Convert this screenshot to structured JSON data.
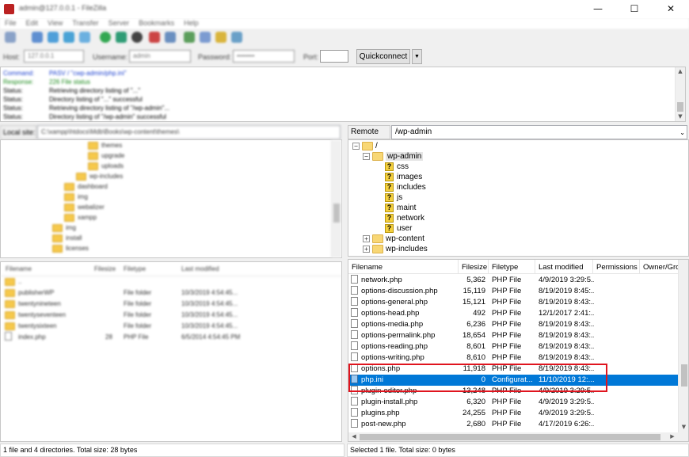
{
  "window": {
    "title": "admin@127.0.0.1 - FileZilla",
    "controls": {
      "minimize": "—",
      "maximize": "☐",
      "close": "✕"
    }
  },
  "menu": [
    "File",
    "Edit",
    "View",
    "Transfer",
    "Server",
    "Bookmarks",
    "Help"
  ],
  "quickconnect": {
    "host_label": "Host:",
    "host_value": "127.0.0.1",
    "username_label": "Username:",
    "username_value": "admin",
    "password_label": "Password:",
    "password_value": "••••••••",
    "port_label": "Port:",
    "port_value": "",
    "button_label": "Quickconnect",
    "dropdown_arrow": "▼"
  },
  "log": [
    {
      "type": "Command:",
      "text": "PASV / \"cwp-admin/php.ini\"",
      "color": "#1a3fcf"
    },
    {
      "type": "Response:",
      "text": "226 File status",
      "color": "#1a8a1a"
    },
    {
      "type": "Status:",
      "text": "Retrieving directory listing of \"...\"",
      "color": "#000000"
    },
    {
      "type": "Status:",
      "text": "Directory listing of \"...\" successful",
      "color": "#000000"
    },
    {
      "type": "Status:",
      "text": "Retrieving directory listing of \"/wp-admin\"...",
      "color": "#000000"
    },
    {
      "type": "Status:",
      "text": "Directory listing of \"/wp-admin\" successful",
      "color": "#000000"
    }
  ],
  "local": {
    "site_label": "Local site:",
    "site_path": "C:\\xampp\\htdocs\\Mdb\\Books\\wp-content\\themes\\",
    "tree": [
      {
        "indent": 110,
        "label": "themes"
      },
      {
        "indent": 110,
        "label": "upgrade"
      },
      {
        "indent": 110,
        "label": "uploads"
      },
      {
        "indent": 95,
        "label": "wp-includes"
      },
      {
        "indent": 80,
        "label": "dashboard"
      },
      {
        "indent": 80,
        "label": "img"
      },
      {
        "indent": 80,
        "label": "webalizer"
      },
      {
        "indent": 80,
        "label": "xampp"
      },
      {
        "indent": 65,
        "label": "img"
      },
      {
        "indent": 65,
        "label": "install"
      },
      {
        "indent": 65,
        "label": "licenses"
      }
    ],
    "columns": [
      "Filename",
      "Filesize",
      "Filetype",
      "Last modified"
    ],
    "files": [
      {
        "name": "..",
        "size": "",
        "type": "",
        "modified": "",
        "folder": true
      },
      {
        "name": "publisherWP",
        "size": "",
        "type": "File folder",
        "modified": "10/3/2019 4:54:45...",
        "folder": true
      },
      {
        "name": "twentynineteen",
        "size": "",
        "type": "File folder",
        "modified": "10/3/2019 4:54:45...",
        "folder": true
      },
      {
        "name": "twentyseventeen",
        "size": "",
        "type": "File folder",
        "modified": "10/3/2019 4:54:45...",
        "folder": true
      },
      {
        "name": "twentysixteen",
        "size": "",
        "type": "File folder",
        "modified": "10/3/2019 4:54:45...",
        "folder": true
      },
      {
        "name": "index.php",
        "size": "28",
        "type": "PHP File",
        "modified": "6/5/2014 4:54:45 PM",
        "folder": false
      }
    ],
    "status": "1 file and 4 directories. Total size: 28 bytes"
  },
  "remote": {
    "site_label": "Remote site:",
    "site_path": "/wp-admin",
    "tree": [
      {
        "label": "/",
        "kind": "folder",
        "expander": "−",
        "x": 5
      },
      {
        "label": "wp-admin",
        "kind": "folder",
        "expander": "−",
        "x": 18,
        "selected": true
      },
      {
        "label": "css",
        "kind": "unknown",
        "expander": "",
        "x": 44
      },
      {
        "label": "images",
        "kind": "unknown",
        "expander": "",
        "x": 44
      },
      {
        "label": "includes",
        "kind": "unknown",
        "expander": "",
        "x": 44
      },
      {
        "label": "js",
        "kind": "unknown",
        "expander": "",
        "x": 44
      },
      {
        "label": "maint",
        "kind": "unknown",
        "expander": "",
        "x": 44
      },
      {
        "label": "network",
        "kind": "unknown",
        "expander": "",
        "x": 44
      },
      {
        "label": "user",
        "kind": "unknown",
        "expander": "",
        "x": 44
      },
      {
        "label": "wp-content",
        "kind": "folder",
        "expander": "+",
        "x": 18
      },
      {
        "label": "wp-includes",
        "kind": "folder",
        "expander": "+",
        "x": 18
      }
    ],
    "columns": [
      "Filename",
      "Filesize",
      "Filetype",
      "Last modified",
      "Permissions",
      "Owner/Gro"
    ],
    "files": [
      {
        "name": "network.php",
        "size": "5,362",
        "type": "PHP File",
        "modified": "4/9/2019 3:29:5..."
      },
      {
        "name": "options-discussion.php",
        "size": "15,119",
        "type": "PHP File",
        "modified": "8/19/2019 8:45:..."
      },
      {
        "name": "options-general.php",
        "size": "15,121",
        "type": "PHP File",
        "modified": "8/19/2019 8:43:..."
      },
      {
        "name": "options-head.php",
        "size": "492",
        "type": "PHP File",
        "modified": "12/1/2017 2:41:..."
      },
      {
        "name": "options-media.php",
        "size": "6,236",
        "type": "PHP File",
        "modified": "8/19/2019 8:43:..."
      },
      {
        "name": "options-permalink.php",
        "size": "18,654",
        "type": "PHP File",
        "modified": "8/19/2019 8:43:..."
      },
      {
        "name": "options-reading.php",
        "size": "8,601",
        "type": "PHP File",
        "modified": "8/19/2019 8:43:..."
      },
      {
        "name": "options-writing.php",
        "size": "8,610",
        "type": "PHP File",
        "modified": "8/19/2019 8:43:..."
      },
      {
        "name": "options.php",
        "size": "11,918",
        "type": "PHP File",
        "modified": "8/19/2019 8:43:..."
      },
      {
        "name": "php.ini",
        "size": "0",
        "type": "Configurat...",
        "modified": "11/10/2019 12:...",
        "selected": true
      },
      {
        "name": "plugin-editor.php",
        "size": "13,248",
        "type": "PHP File",
        "modified": "4/9/2019 3:29:5..."
      },
      {
        "name": "plugin-install.php",
        "size": "6,320",
        "type": "PHP File",
        "modified": "4/9/2019 3:29:5..."
      },
      {
        "name": "plugins.php",
        "size": "24,255",
        "type": "PHP File",
        "modified": "4/9/2019 3:29:5..."
      },
      {
        "name": "post-new.php",
        "size": "2,680",
        "type": "PHP File",
        "modified": "4/17/2019 6:26:..."
      }
    ],
    "status": "Selected 1 file. Total size: 0 bytes"
  },
  "colors": {
    "selection": "#0078d7",
    "highlight_box": "#e0141e",
    "folder": "#f8d775"
  }
}
